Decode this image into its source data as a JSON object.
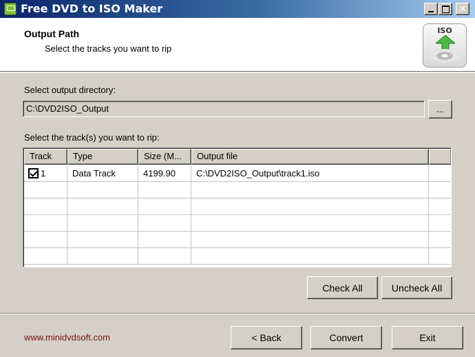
{
  "window": {
    "title": "Free DVD to ISO Maker"
  },
  "header": {
    "title": "Output Path",
    "subtitle": "Select the tracks you want to rip",
    "logo_text": "ISO"
  },
  "output": {
    "label": "Select output directory:",
    "value": "C:\\DVD2ISO_Output",
    "browse_label": "..."
  },
  "tracks": {
    "label": "Select the track(s) you want to rip:",
    "columns": [
      "Track",
      "Type",
      "Size (M...",
      "Output file"
    ],
    "rows": [
      {
        "checked": true,
        "track": "1",
        "type": "Data Track",
        "size": "4199.90",
        "output_file": "C:\\DVD2ISO_Output\\track1.iso"
      }
    ]
  },
  "actions": {
    "check_all": "Check All",
    "uncheck_all": "Uncheck All",
    "back": "< Back",
    "convert": "Convert",
    "exit": "Exit"
  },
  "footer": {
    "website": "www.minidvdsoft.com"
  },
  "icons": {
    "app": "app-icon",
    "minimize": "minimize-icon",
    "maximize": "maximize-icon",
    "close": "close-icon",
    "logo": "iso-disc-logo-icon",
    "checkbox": "checkbox-checked-icon"
  },
  "colors": {
    "titlebar_start": "#0a246a",
    "titlebar_end": "#a6caf0",
    "window_bg": "#d4d0c8",
    "website_link": "#7a1010"
  }
}
